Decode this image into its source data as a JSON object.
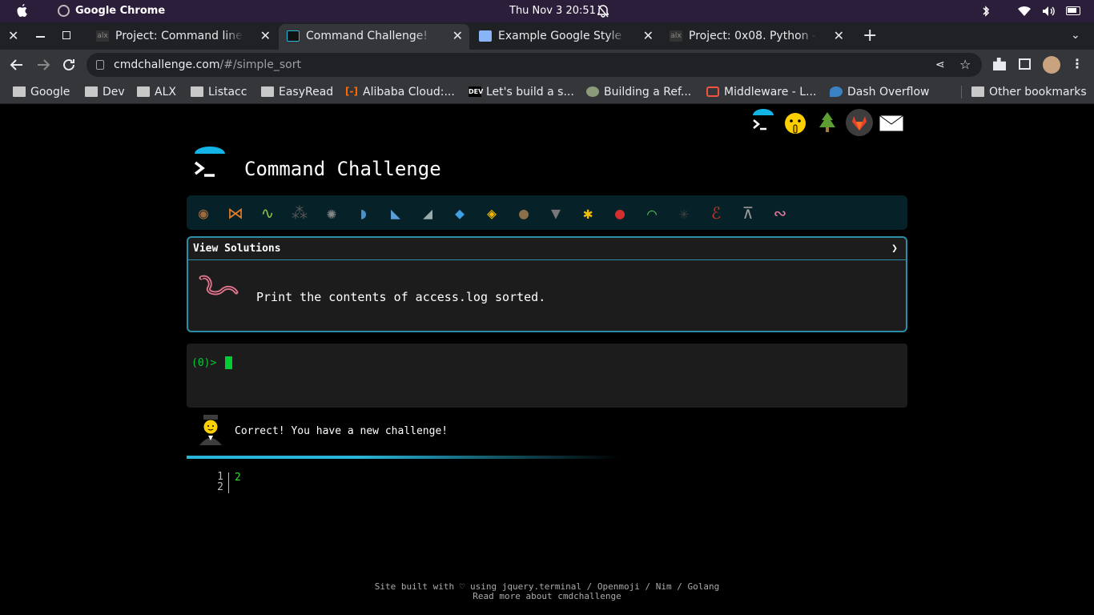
{
  "os": {
    "app_name": "Google Chrome",
    "clock": "Thu Nov 3  20:51"
  },
  "tabs": [
    {
      "title": "Project: Command line for",
      "active": false
    },
    {
      "title": "Command Challenge!",
      "active": true
    },
    {
      "title": "Example Google Style Pyth",
      "active": false
    },
    {
      "title": "Project: 0x08. Python - Mo",
      "active": false
    }
  ],
  "address": {
    "host": "cmdchallenge.com",
    "path": "/#/simple_sort"
  },
  "bookmarks": [
    {
      "label": "Google",
      "icon": "folder-icon"
    },
    {
      "label": "Dev",
      "icon": "folder-icon"
    },
    {
      "label": "ALX",
      "icon": "folder-icon"
    },
    {
      "label": "Listacc",
      "icon": "folder-icon"
    },
    {
      "label": "EasyRead",
      "icon": "folder-icon"
    },
    {
      "label": "Alibaba Cloud:...",
      "icon": "alibaba-icon"
    },
    {
      "label": "Let's build a s...",
      "icon": "dev-icon"
    },
    {
      "label": "Building a Ref...",
      "icon": "globe-icon"
    },
    {
      "label": "Middleware - L...",
      "icon": "laravel-icon"
    },
    {
      "label": "Dash Overflow",
      "icon": "bird-icon"
    }
  ],
  "other_bookmarks": "Other bookmarks",
  "page": {
    "title": "Command Challenge",
    "solutions_header": "View Solutions",
    "solutions_chevron": "❯",
    "challenge_text": "Print the contents of access.log sorted.",
    "prompt": "(0)>",
    "correct_message": "Correct! You have a new challenge!",
    "line_numbers": [
      "1",
      "2"
    ],
    "output_lines": [
      "2"
    ],
    "footer_line1": "Site built with ♡ using jquery.terminal / Openmoji / Nim / Golang",
    "footer_line2": "Read more about cmdchallenge",
    "critters": [
      "snail",
      "butterfly",
      "caterpillar",
      "ant",
      "web",
      "whale",
      "shark",
      "dolphin",
      "fish",
      "tropical-fish",
      "otter",
      "wolf",
      "bee",
      "ladybug",
      "lizard",
      "spider",
      "scorpion",
      "fly",
      "worm"
    ]
  },
  "colors": {
    "accent": "#29b6d8",
    "prompt_green": "#00cc33",
    "panel": "#1c1c1c",
    "critter_bar": "#062127"
  }
}
